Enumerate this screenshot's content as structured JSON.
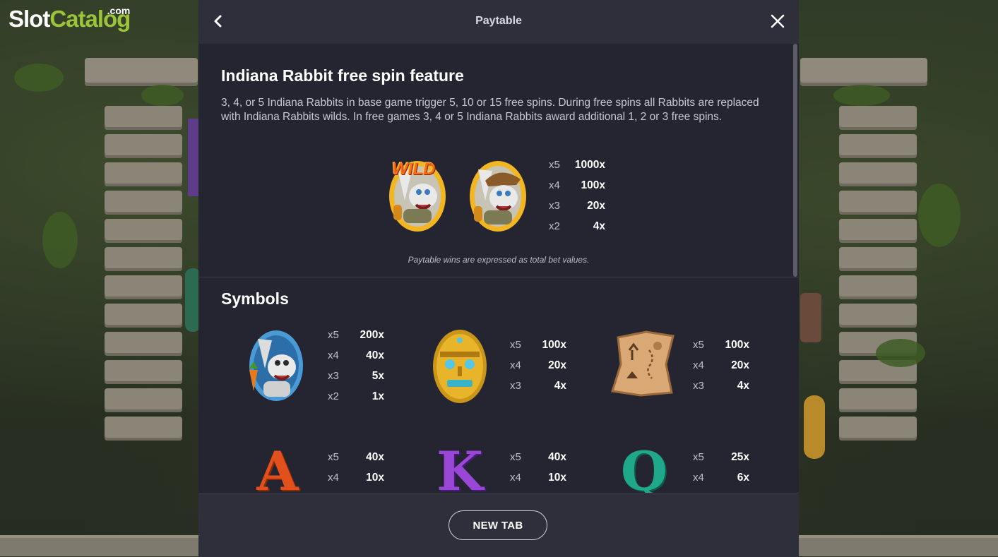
{
  "brand": {
    "logo_slot": "Slot",
    "logo_catalog": "Catalog",
    "logo_com": ".com"
  },
  "header": {
    "title": "Paytable",
    "back_icon": "chevron-left-icon",
    "close_icon": "close-icon"
  },
  "feature": {
    "title": "Indiana Rabbit free spin feature",
    "description": "3, 4, or 5 Indiana Rabbits in base game trigger 5, 10 or 15 free spins. During free spins all Rabbits are replaced with Indiana Rabbits wilds. In free games 3, 4 or 5 Indiana Rabbits award additional 1, 2 or 3 free spins.",
    "wild_text": "WILD",
    "pays": [
      {
        "count": "x5",
        "value": "1000x"
      },
      {
        "count": "x4",
        "value": "100x"
      },
      {
        "count": "x3",
        "value": "20x"
      },
      {
        "count": "x2",
        "value": "4x"
      }
    ],
    "note": "Paytable wins are expressed as total bet values."
  },
  "symbols": {
    "title": "Symbols",
    "items": [
      {
        "name": "rabbit-symbol",
        "pays": [
          {
            "count": "x5",
            "value": "200x"
          },
          {
            "count": "x4",
            "value": "40x"
          },
          {
            "count": "x3",
            "value": "5x"
          },
          {
            "count": "x2",
            "value": "1x"
          }
        ]
      },
      {
        "name": "golden-mask-symbol",
        "pays": [
          {
            "count": "x5",
            "value": "100x"
          },
          {
            "count": "x4",
            "value": "20x"
          },
          {
            "count": "x3",
            "value": "4x"
          }
        ]
      },
      {
        "name": "treasure-map-symbol",
        "pays": [
          {
            "count": "x5",
            "value": "100x"
          },
          {
            "count": "x4",
            "value": "20x"
          },
          {
            "count": "x3",
            "value": "4x"
          }
        ]
      },
      {
        "name": "letter-a-symbol",
        "letter": "A",
        "pays": [
          {
            "count": "x5",
            "value": "40x"
          },
          {
            "count": "x4",
            "value": "10x"
          }
        ]
      },
      {
        "name": "letter-k-symbol",
        "letter": "K",
        "pays": [
          {
            "count": "x5",
            "value": "40x"
          },
          {
            "count": "x4",
            "value": "10x"
          }
        ]
      },
      {
        "name": "letter-q-symbol",
        "letter": "Q",
        "pays": [
          {
            "count": "x5",
            "value": "25x"
          },
          {
            "count": "x4",
            "value": "6x"
          }
        ]
      }
    ]
  },
  "footer": {
    "new_tab_label": "NEW TAB"
  },
  "colors": {
    "modal_bg": "#242530",
    "header_bg": "#2e2f3b",
    "text_primary": "#ffffff",
    "text_secondary": "#c7c8d1",
    "logo_green": "#9cc43a"
  }
}
